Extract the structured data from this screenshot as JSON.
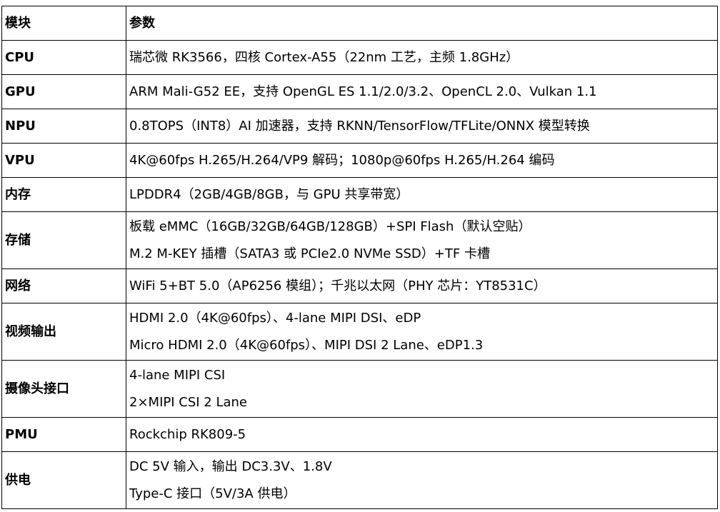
{
  "header": {
    "col1": "模块",
    "col2": "参数"
  },
  "rows": [
    {
      "key": "CPU",
      "values": [
        "瑞芯微 RK3566，四核 Cortex-A55（22nm 工艺，主频 1.8GHz）"
      ]
    },
    {
      "key": "GPU",
      "values": [
        "ARM Mali-G52 EE，支持 OpenGL ES 1.1/2.0/3.2、OpenCL 2.0、Vulkan 1.1"
      ]
    },
    {
      "key": "NPU",
      "values": [
        "0.8TOPS（INT8）AI 加速器，支持 RKNN/TensorFlow/TFLite/ONNX 模型转换"
      ]
    },
    {
      "key": "VPU",
      "values": [
        "4K@60fps H.265/H.264/VP9 解码；1080p@60fps H.265/H.264 编码"
      ]
    },
    {
      "key": "内存",
      "values": [
        "LPDDR4（2GB/4GB/8GB，与 GPU 共享带宽）"
      ]
    },
    {
      "key": "存储",
      "values": [
        "板载 eMMC（16GB/32GB/64GB/128GB）+SPI Flash（默认空贴）",
        "M.2 M-KEY 插槽（SATA3 或 PCIe2.0 NVMe SSD）+TF 卡槽"
      ]
    },
    {
      "key": "网络",
      "values": [
        "WiFi 5+BT 5.0（AP6256 模组）；千兆以太网（PHY 芯片：YT8531C）"
      ]
    },
    {
      "key": "视频输出",
      "values": [
        "HDMI 2.0（4K@60fps）、4-lane MIPI DSI、eDP",
        "Micro HDMI 2.0（4K@60fps）、MIPI DSI 2 Lane、eDP1.3"
      ]
    },
    {
      "key": "摄像头接口",
      "values": [
        "4-lane MIPI CSI",
        "2×MIPI CSI 2 Lane"
      ]
    },
    {
      "key": "PMU",
      "values": [
        "Rockchip RK809-5"
      ]
    },
    {
      "key": "供电",
      "values": [
        "DC 5V 输入，输出 DC3.3V、1.8V",
        "Type-C 接口（5V/3A 供电）"
      ]
    }
  ]
}
